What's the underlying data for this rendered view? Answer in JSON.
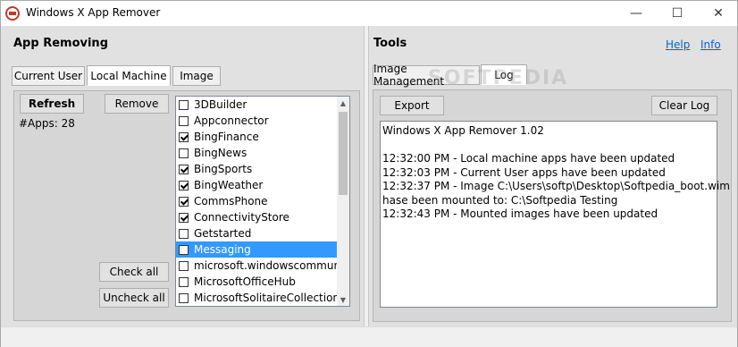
{
  "window": {
    "title": "Windows X App Remover",
    "minimize": "—",
    "maximize": "☐",
    "close": "✕"
  },
  "left": {
    "title": "App Removing",
    "tabs": [
      {
        "label": "Current User",
        "active": false
      },
      {
        "label": "Local Machine",
        "active": true
      },
      {
        "label": "Image",
        "active": false
      }
    ],
    "refresh_label": "Refresh",
    "remove_label": "Remove",
    "apps_count": "#Apps: 28",
    "check_all_label": "Check all",
    "uncheck_all_label": "Uncheck all",
    "apps": [
      {
        "name": "3DBuilder",
        "checked": false,
        "selected": false
      },
      {
        "name": "Appconnector",
        "checked": false,
        "selected": false
      },
      {
        "name": "BingFinance",
        "checked": true,
        "selected": false
      },
      {
        "name": "BingNews",
        "checked": false,
        "selected": false
      },
      {
        "name": "BingSports",
        "checked": true,
        "selected": false
      },
      {
        "name": "BingWeather",
        "checked": true,
        "selected": false
      },
      {
        "name": "CommsPhone",
        "checked": true,
        "selected": false
      },
      {
        "name": "ConnectivityStore",
        "checked": true,
        "selected": false
      },
      {
        "name": "Getstarted",
        "checked": false,
        "selected": false
      },
      {
        "name": "Messaging",
        "checked": false,
        "selected": true
      },
      {
        "name": "microsoft.windowscommunic",
        "checked": false,
        "selected": false
      },
      {
        "name": "MicrosoftOfficeHub",
        "checked": false,
        "selected": false
      },
      {
        "name": "MicrosoftSolitaireCollection",
        "checked": false,
        "selected": false
      }
    ]
  },
  "right": {
    "title": "Tools",
    "help_label": "Help",
    "info_label": "Info",
    "tabs": [
      {
        "label": "Image Management",
        "active": false
      },
      {
        "label": "Log",
        "active": true
      }
    ],
    "export_label": "Export",
    "clear_log_label": "Clear Log",
    "log_lines": [
      "Windows X App Remover 1.02",
      "",
      "12:32:00 PM - Local machine apps have been updated",
      "12:32:03 PM - Current User apps have been updated",
      "12:32:37 PM - Image C:\\Users\\softp\\Desktop\\Softpedia_boot.wim",
      "hase been mounted to: C:\\Softpedia Testing",
      "12:32:43 PM - Mounted images have been updated"
    ]
  },
  "watermark": "SOFTPEDIA",
  "colors": {
    "selection": "#3399ff",
    "link": "#0066cc"
  }
}
